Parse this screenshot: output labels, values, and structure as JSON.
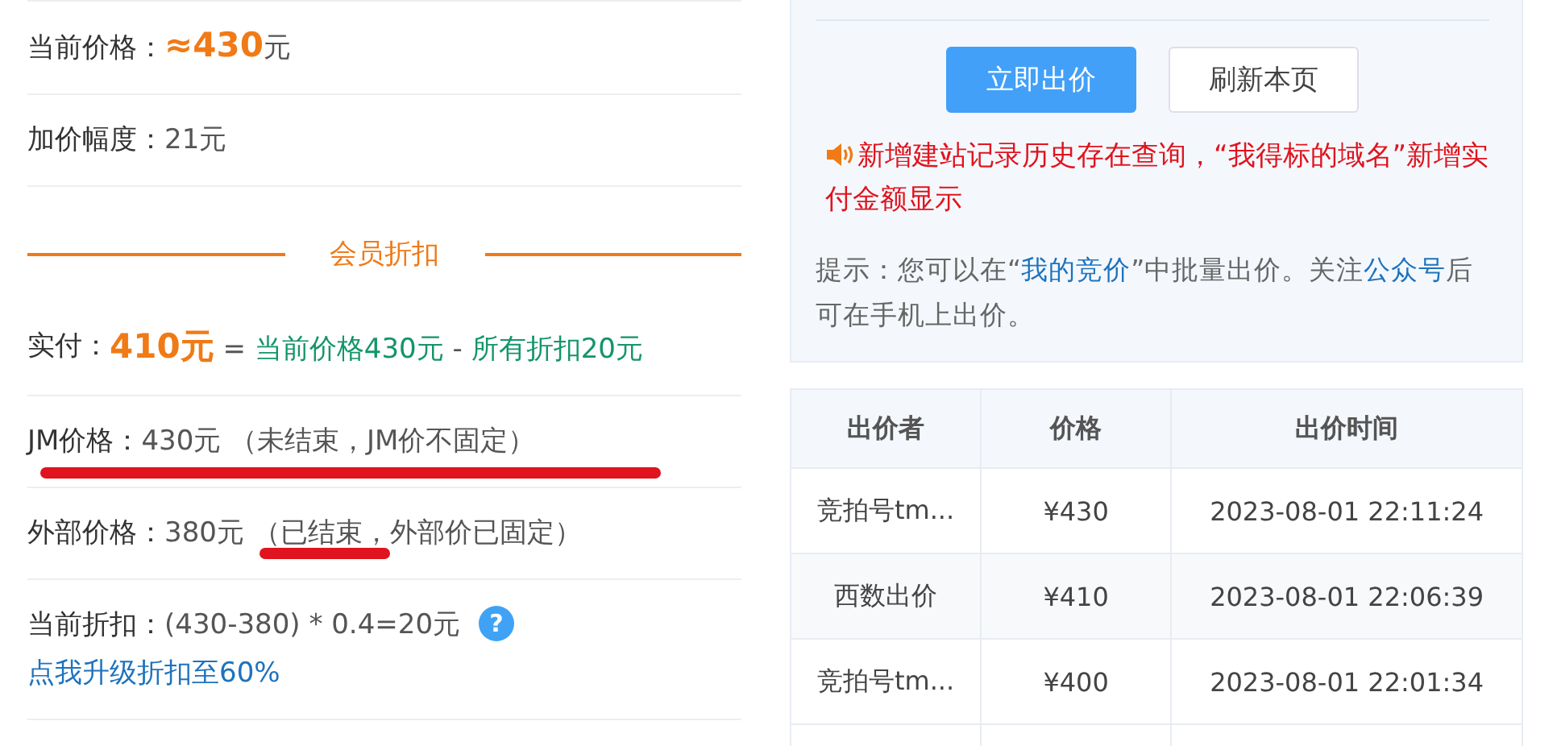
{
  "price_rows": [
    {
      "kind": "info",
      "underlined": false,
      "segments": [
        {
          "text": "当前价格：",
          "kind": "label"
        },
        {
          "text": "≈430",
          "kind": "accent"
        },
        {
          "text": "元",
          "kind": "plain"
        }
      ]
    },
    {
      "kind": "info",
      "underlined": false,
      "segments": [
        {
          "text": "加价幅度：",
          "kind": "label"
        },
        {
          "text": "21元",
          "kind": "plain"
        }
      ]
    }
  ],
  "divider": {
    "label": "会员折扣"
  },
  "discount_rows": [
    {
      "kind": "formula",
      "underlined": false,
      "segments": [
        {
          "text": "实付：",
          "kind": "label"
        },
        {
          "text": "410元",
          "kind": "accent"
        },
        {
          "text": " = ",
          "kind": "plain"
        },
        {
          "text": "当前价格430元",
          "kind": "green"
        },
        {
          "text": " - ",
          "kind": "plain"
        },
        {
          "text": "所有折扣20元",
          "kind": "green"
        }
      ]
    },
    {
      "kind": "info",
      "underlined": true,
      "segments": [
        {
          "text": "JM价格：",
          "kind": "label"
        },
        {
          "text": "430元 （未结束，JM价不固定）",
          "kind": "plain"
        }
      ]
    },
    {
      "kind": "info",
      "underlined": false,
      "segments": [
        {
          "text": "外部价格：",
          "kind": "label"
        },
        {
          "text": "380元 ",
          "kind": "plain"
        },
        {
          "text": "（已结束，",
          "kind": "plain",
          "underlined": true
        },
        {
          "text": "外部价已固定）",
          "kind": "plain"
        }
      ]
    },
    {
      "kind": "info",
      "underlined": false,
      "segments": [
        {
          "text": "当前折扣：",
          "kind": "label"
        },
        {
          "text": "(430-380) * 0.4=20元 ",
          "kind": "plain"
        },
        {
          "text": "?",
          "kind": "help"
        },
        {
          "text": "点我升级折扣至60%",
          "kind": "link"
        }
      ]
    }
  ],
  "actions": {
    "buttons": [
      {
        "label": "立即出价",
        "kind": "primary"
      },
      {
        "label": "刷新本页",
        "kind": "default"
      }
    ]
  },
  "notice": {
    "text": "新增建站记录历史存在查询，“我得标的域名”新增实付金额显示"
  },
  "tip": {
    "segments": [
      {
        "text": "提示：您可以在“",
        "kind": "plain"
      },
      {
        "text": "我的竞价",
        "kind": "link"
      },
      {
        "text": "”中批量出价。关注",
        "kind": "plain"
      },
      {
        "text": "公众号",
        "kind": "link"
      },
      {
        "text": "后可在手机上出价。",
        "kind": "plain"
      }
    ]
  },
  "bids_table": {
    "columns": [
      "出价者",
      "价格",
      "出价时间"
    ],
    "rows": [
      [
        "竞拍号tm...",
        "¥430",
        "2023-08-01 22:11:24"
      ],
      [
        "西数出价",
        "¥410",
        "2023-08-01 22:06:39"
      ],
      [
        "竞拍号tm...",
        "¥400",
        "2023-08-01 22:01:34"
      ]
    ]
  }
}
